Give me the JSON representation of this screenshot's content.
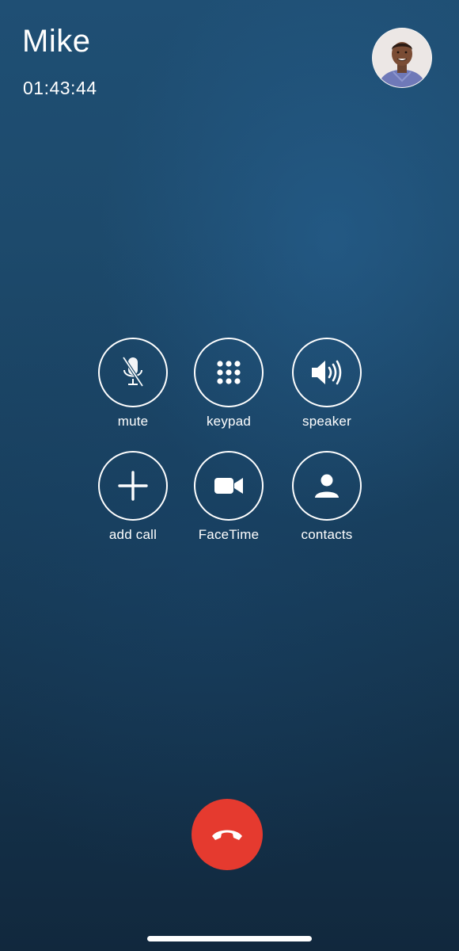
{
  "call": {
    "caller_name": "Mike",
    "duration": "01:43:44"
  },
  "avatar": {
    "description": "contact-photo"
  },
  "controls": {
    "mute": {
      "label": "mute",
      "icon": "microphone-slash-icon"
    },
    "keypad": {
      "label": "keypad",
      "icon": "keypad-grid-icon"
    },
    "speaker": {
      "label": "speaker",
      "icon": "speaker-icon"
    },
    "add_call": {
      "label": "add call",
      "icon": "plus-icon"
    },
    "facetime": {
      "label": "FaceTime",
      "icon": "video-camera-icon"
    },
    "contacts": {
      "label": "contacts",
      "icon": "person-icon"
    }
  },
  "end_call": {
    "icon": "phone-hangup-icon",
    "color": "#e53a2f"
  },
  "theme": {
    "background_top": "#1f4f74",
    "background_bottom": "#11283d",
    "foreground": "#ffffff"
  }
}
